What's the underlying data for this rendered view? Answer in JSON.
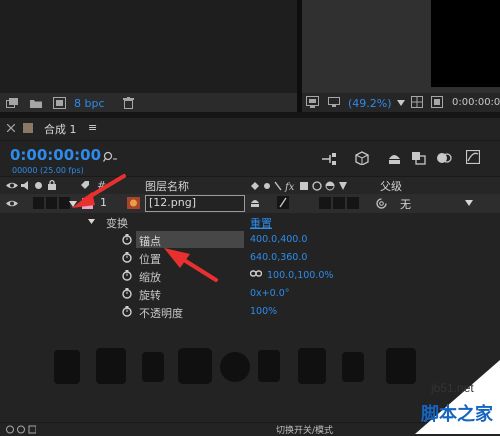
{
  "project": {
    "bpc_label": "8 bpc"
  },
  "viewer": {
    "zoom": "(49.2%)",
    "timecode": "0:00:00:00"
  },
  "comp": {
    "tab_label": "合成 1",
    "menu_icon": "≡",
    "timecode": "0:00:00:00",
    "frame_info": "00000 (25.00 fps)",
    "search_icon": "search-icon"
  },
  "columns": {
    "hash": "#",
    "layer_name": "图层名称",
    "parent": "父级"
  },
  "layer": {
    "index": "1",
    "name": "[12.png]",
    "parent_value": "无"
  },
  "transform": {
    "label": "变换",
    "reset": "重置",
    "properties": [
      {
        "name": "锚点",
        "value": "400.0,400.0"
      },
      {
        "name": "位置",
        "value": "640.0,360.0"
      },
      {
        "name": "缩放",
        "value": "100.0,100.0%"
      },
      {
        "name": "旋转",
        "value": "0x+0.0°"
      },
      {
        "name": "不透明度",
        "value": "100%"
      }
    ]
  },
  "footer": {
    "toggle_label": "切换开关/模式"
  },
  "watermark": {
    "site": "jb51.net",
    "brand": "脚本之家"
  },
  "colors": {
    "accent_blue": "#2d8ceb",
    "arrow_red": "#e8312f",
    "label_pink": "#e9a4c9",
    "watermark_blue": "#1565c0"
  }
}
